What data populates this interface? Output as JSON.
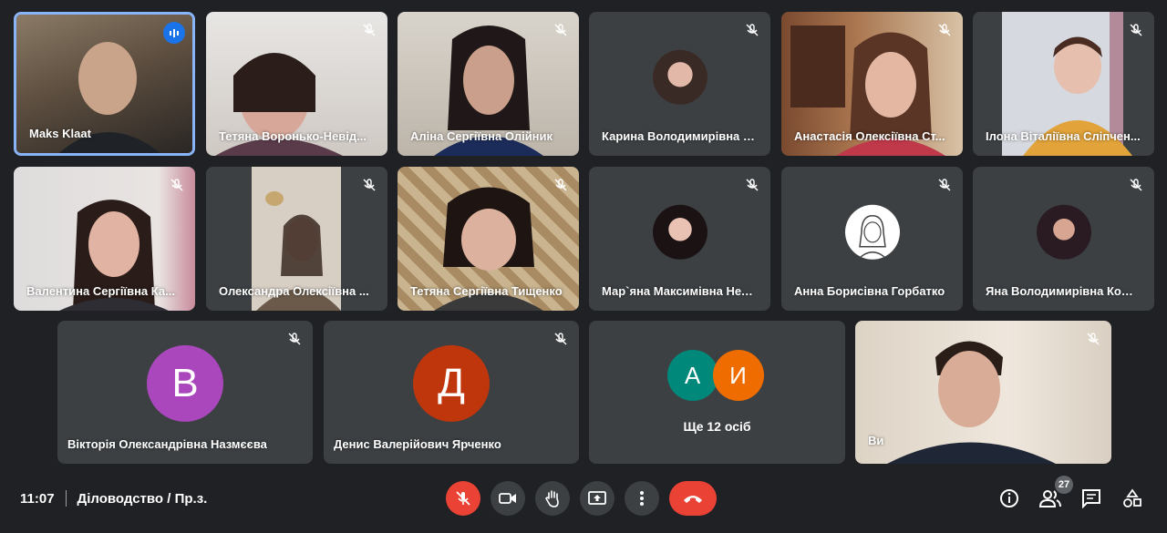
{
  "participants": [
    {
      "name": "Maks Klaat"
    },
    {
      "name": "Тетяна Воронько-Невід..."
    },
    {
      "name": "Аліна Сергіївна Олійник"
    },
    {
      "name": "Карина Володимирівна Р..."
    },
    {
      "name": "Анастасія Олексіївна Ст..."
    },
    {
      "name": "Ілона Віталіївна Сліпчен..."
    },
    {
      "name": "Валентина Сергіївна Ка..."
    },
    {
      "name": "Олександра Олексіївна ..."
    },
    {
      "name": "Тетяна Сергіївна Тищенко"
    },
    {
      "name": "Мар`яна Максимівна Неч..."
    },
    {
      "name": "Анна Борисівна Горбатко"
    },
    {
      "name": "Яна Володимирівна Комл..."
    },
    {
      "name": "Вікторія Олександрівна Назмєєва",
      "initial": "В",
      "color": "#ab47bc"
    },
    {
      "name": "Денис Валерійович Ярченко",
      "initial": "Д",
      "color": "#bf360c"
    },
    {
      "name": "Ви"
    }
  ],
  "others_group": {
    "initials": [
      "А",
      "И"
    ],
    "colors": [
      "#00897b",
      "#ef6c00"
    ],
    "label": "Ще 12 осіб"
  },
  "meeting": {
    "time": "11:07",
    "title": "Діловодство / Пр.з."
  },
  "toolbar": {
    "participant_count": "27"
  },
  "colors": {
    "background": "#202124",
    "tile": "#3c4043",
    "active_border": "#8ab4f8",
    "hangup": "#ea4335"
  },
  "icons": {
    "mic_off": "mic-off-icon",
    "speaking": "speaking-indicator-icon",
    "camera": "camera-icon",
    "raise_hand": "raise-hand-icon",
    "present": "present-screen-icon",
    "more": "more-vert-icon",
    "hangup": "hang-up-icon",
    "info": "info-icon",
    "people": "people-icon",
    "chat": "chat-icon",
    "activities": "activities-icon"
  }
}
